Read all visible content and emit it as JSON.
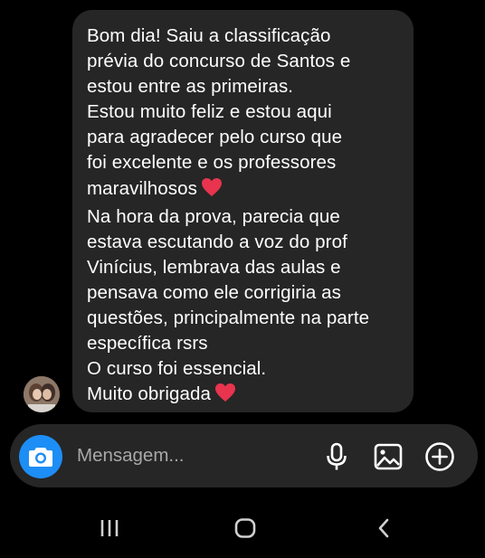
{
  "message": {
    "lines": [
      "Bom dia! Saiu a classificação",
      "prévia do concurso de Santos e",
      "estou entre as primeiras.",
      "Estou muito feliz e estou aqui",
      "para agradecer pelo curso que",
      "foi excelente e os professores",
      "maravilhosos",
      "Na hora da prova, parecia que",
      "estava escutando a voz do prof",
      "Vinícius, lembrava das aulas e",
      "pensava como ele corrigiria as",
      "questões, principalmente na parte",
      "específica rsrs",
      "O curso foi essencial.",
      "Muito obrigada"
    ],
    "emoji": "heart-icon",
    "heart_color": "#e8344e"
  },
  "composer": {
    "placeholder": "Mensagem...",
    "camera_icon": "camera-icon",
    "mic_icon": "microphone-icon",
    "gallery_icon": "gallery-icon",
    "add_icon": "plus-circle-icon",
    "camera_color": "#1d8ef5"
  },
  "navigation": {
    "recent_icon": "recent-apps-icon",
    "home_icon": "home-icon",
    "back_icon": "back-icon"
  },
  "colors": {
    "background": "#000000",
    "bubble": "#262626",
    "text": "#ffffff",
    "placeholder": "#a8a8a8"
  }
}
